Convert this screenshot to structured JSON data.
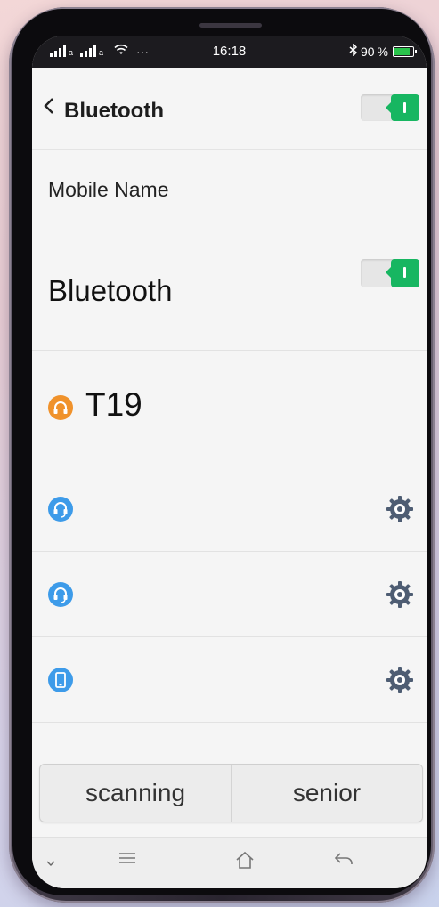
{
  "status_bar": {
    "time": "16:18",
    "battery_percent": "90",
    "battery_unit": "%",
    "wifi_icon": "wifi-icon",
    "more_icon": "···",
    "bluetooth_icon": "bluetooth-icon",
    "battery_level": 0.9,
    "battery_color": "#29c34b"
  },
  "header": {
    "back_icon": "chevron-left-icon",
    "title": "Bluetooth",
    "toggle_on": true
  },
  "settings": {
    "mobile_name_label": "Mobile Name",
    "bluetooth_label": "Bluetooth",
    "bluetooth_on": true
  },
  "connected_device": {
    "name": "T19",
    "icon": "headphones-icon",
    "icon_color": "#f0922b"
  },
  "devices": [
    {
      "icon": "headset-icon",
      "icon_color": "#3d9be9",
      "settings_icon": "gear-icon"
    },
    {
      "icon": "headset-icon",
      "icon_color": "#3d9be9",
      "settings_icon": "gear-icon"
    },
    {
      "icon": "phone-icon",
      "icon_color": "#3d9be9",
      "settings_icon": "gear-icon"
    }
  ],
  "actions": {
    "scan_label": "scanning",
    "senior_label": "senior"
  },
  "nav": {
    "collapse_icon": "chevron-down-icon",
    "menu_icon": "menu-icon",
    "home_icon": "home-icon",
    "back_icon": "back-arrow-icon"
  },
  "colors": {
    "toggle_green": "#17b661",
    "gear_color": "#4e5d73"
  }
}
